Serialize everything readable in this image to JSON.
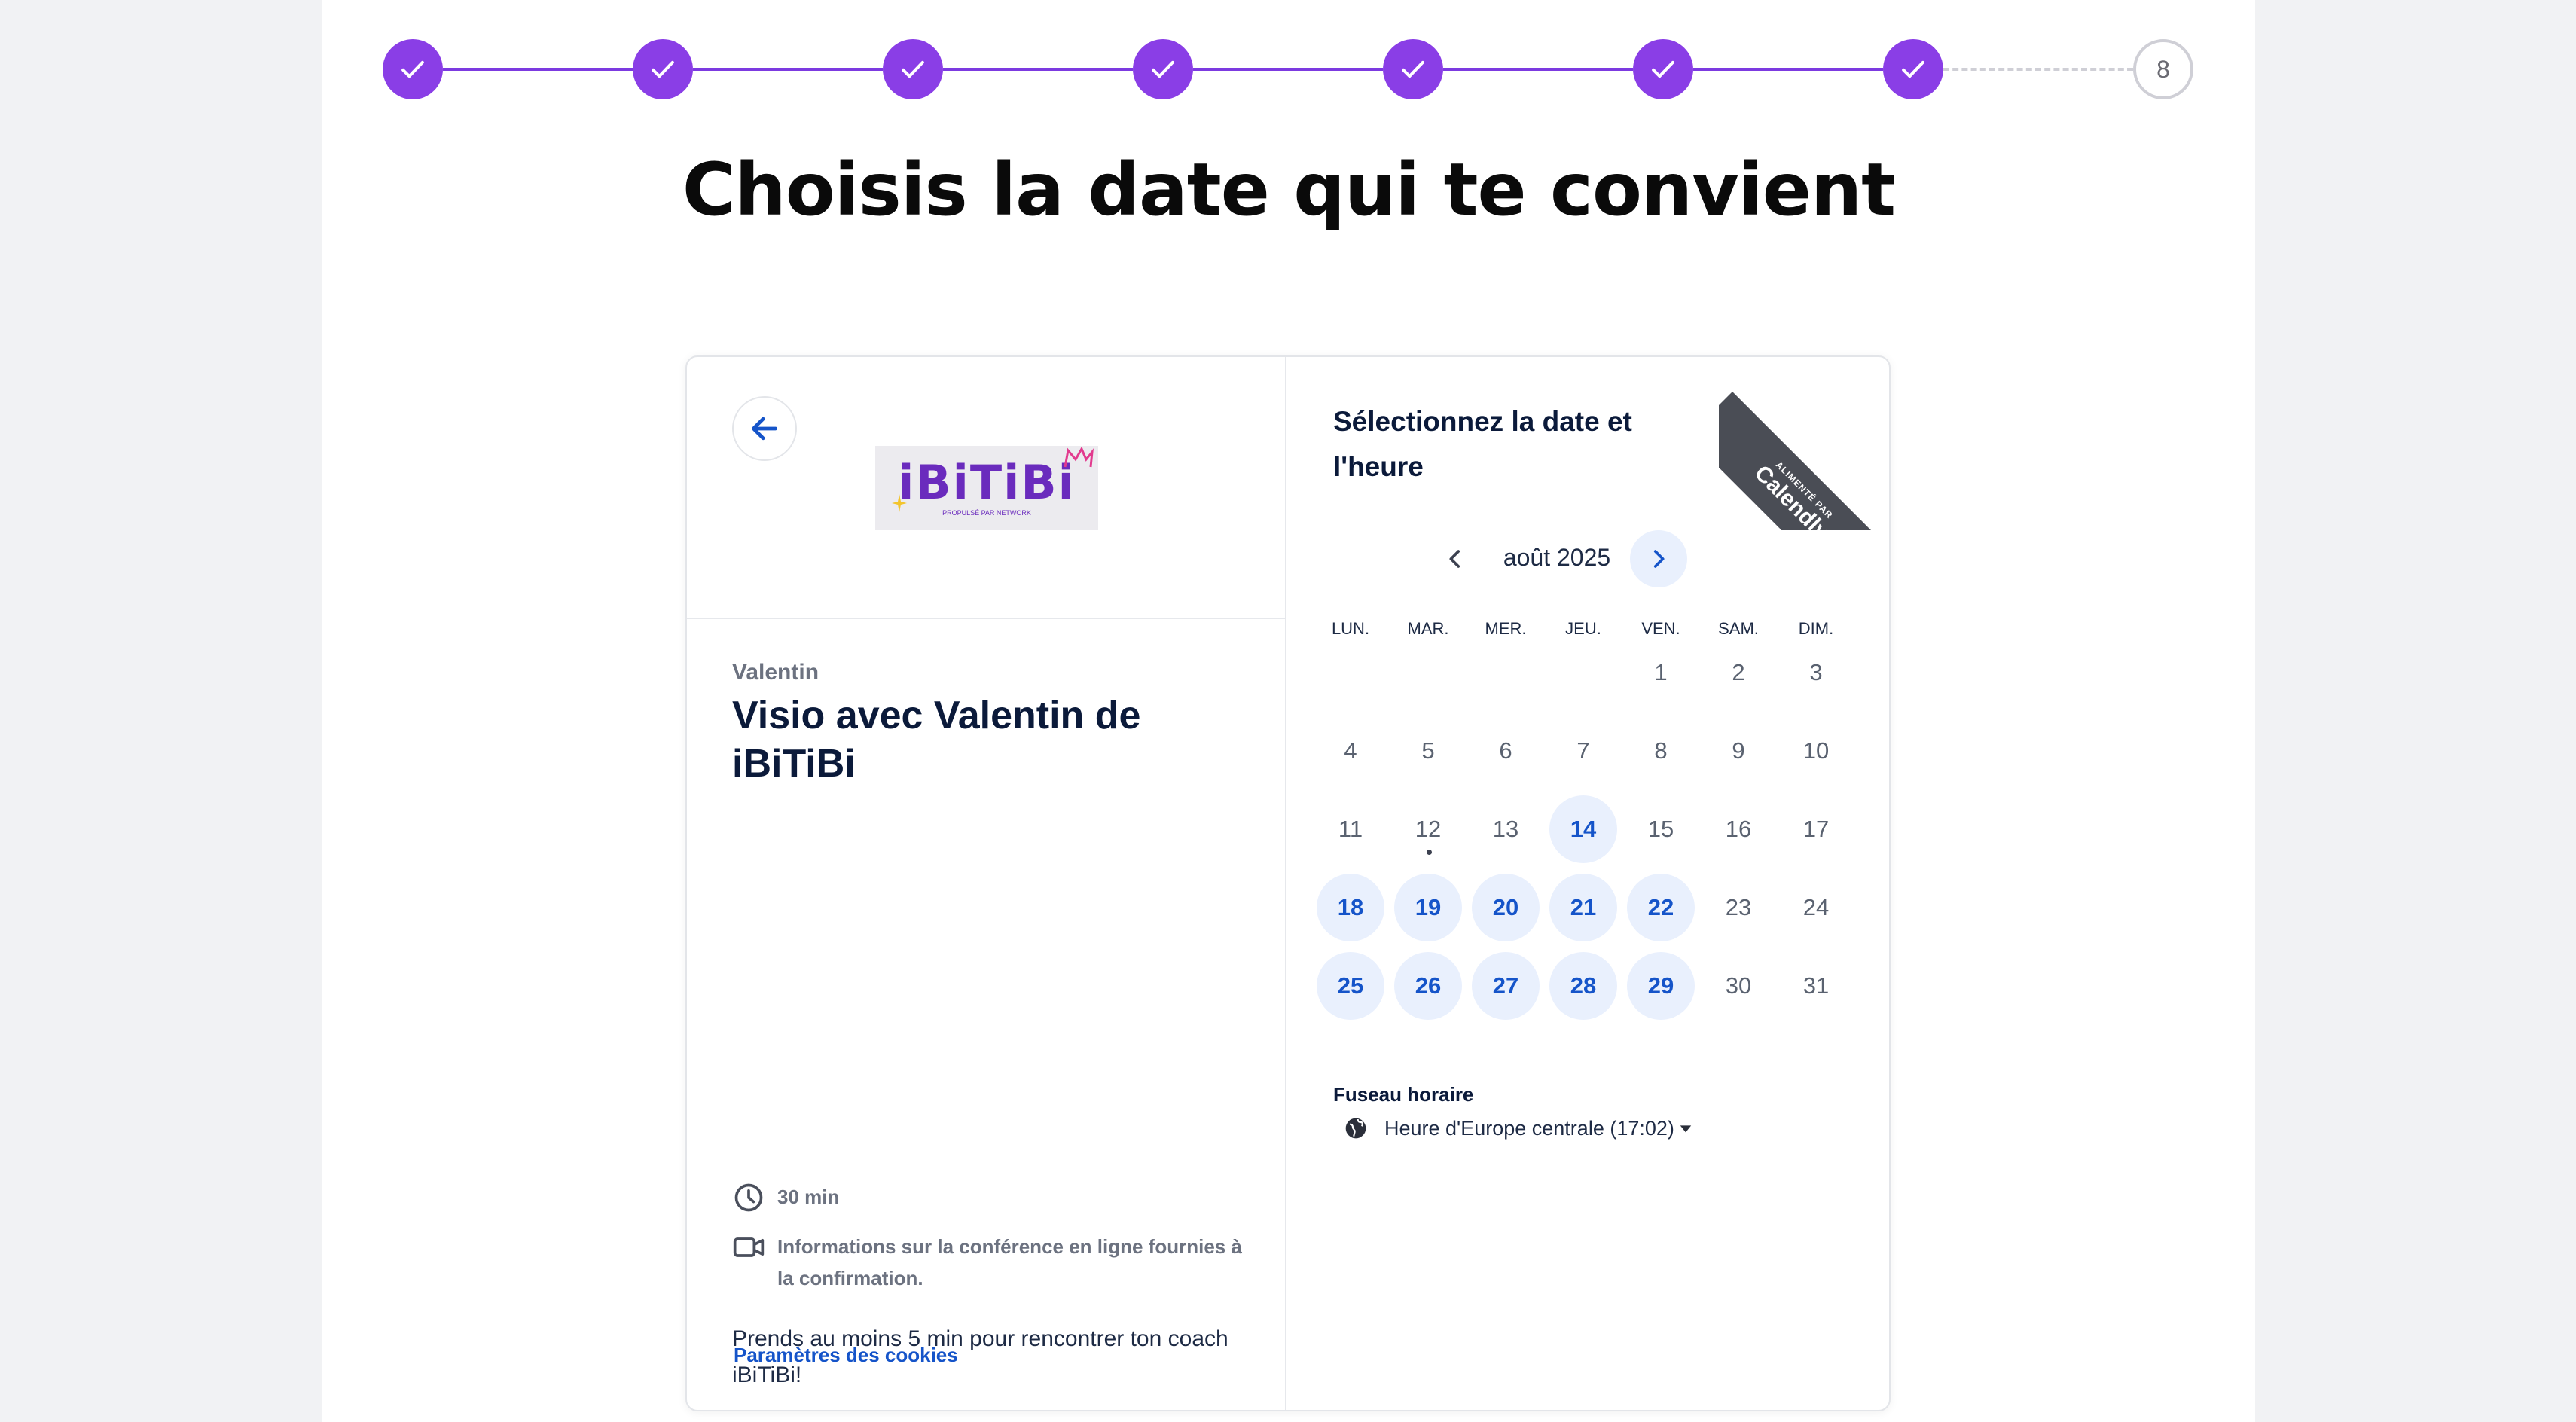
{
  "stepper": {
    "completed_steps": 7,
    "pending_step_label": "8"
  },
  "heading": "Choisis la date qui te convient",
  "event": {
    "logo_text": "iBiTiBi",
    "logo_subtext": "PROPULSÉ PAR NETWORK",
    "organizer": "Valentin",
    "title": "Visio avec Valentin de iBiTiBi",
    "duration": "30 min",
    "conference_info": "Informations sur la conférence en ligne fournies à la confirmation.",
    "description": "Prends au moins 5 min pour rencontrer ton coach iBiTiBi!",
    "cookies_link": "Paramètres des cookies"
  },
  "calendar": {
    "title": "Sélectionnez la date et l'heure",
    "month_label": "août 2025",
    "weekdays": [
      "LUN.",
      "MAR.",
      "MER.",
      "JEU.",
      "VEN.",
      "SAM.",
      "DIM."
    ],
    "first_weekday_index": 4,
    "days_in_month": 31,
    "available_days": [
      14,
      18,
      19,
      20,
      21,
      22,
      25,
      26,
      27,
      28,
      29
    ],
    "today": 12,
    "timezone_label": "Fuseau horaire",
    "timezone_value": "Heure d'Europe centrale (17:02)"
  },
  "ribbon": {
    "small": "ALIMENTÉ PAR",
    "big": "Calendly"
  },
  "colors": {
    "step_purple": "#8a3ee6",
    "calendly_blue": "#1554c9",
    "available_bg": "#e9f0fd"
  }
}
